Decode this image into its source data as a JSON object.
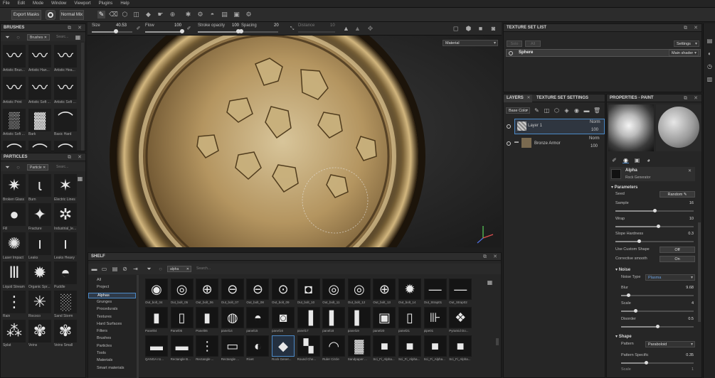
{
  "menu": [
    "File",
    "Edit",
    "Mode",
    "Window",
    "Viewport",
    "Plugins",
    "Help"
  ],
  "toolbar": {
    "export_masks": "Export Masks",
    "normal_mix": "Normal Mix"
  },
  "brush_settings": {
    "size_label": "Size",
    "size_value": "40.53",
    "size_fraction": 0.6,
    "flow_label": "Flow",
    "flow_value": "100",
    "flow_fraction": 1.0,
    "stroke_opacity_label": "Stroke opacity",
    "stroke_opacity_value": "100",
    "stroke_opacity_fraction": 1.0,
    "spacing_label": "Spacing",
    "spacing_value": "20",
    "spacing_fraction": 0.0,
    "distance_label": "Distance",
    "distance_value": "10"
  },
  "brushes": {
    "title": "BRUSHES",
    "tag": "Brushes",
    "search_placeholder": "Searc...",
    "items": [
      "Artistic Brus...",
      "Artistic Han...",
      "Artistic Hea...",
      "Artistic Print",
      "Artistic Soft ...",
      "Artistic Soft ...",
      "Artistic Soft ...",
      "Bark",
      "Basic Hard",
      "",
      "",
      ""
    ]
  },
  "particles": {
    "title": "PARTICLES",
    "tag": "Particle",
    "search_placeholder": "Searc...",
    "items": [
      "Broken Glass",
      "Burn",
      "Electric Lines",
      "Fill",
      "Fracture",
      "Industrial_le...",
      "Laser Impact",
      "Leaks",
      "Leaks Heavy",
      "Liquid Stream",
      "Organic Spr...",
      "Puddle",
      "Rain",
      "Rococo",
      "Sand Storm",
      "Splat",
      "Veins",
      "Veins Small"
    ]
  },
  "viewport": {
    "mode": "Material"
  },
  "texture_set_list": {
    "title": "TEXTURE SET LIST",
    "settings": "Settings",
    "solo": "Solo",
    "all": "All",
    "set_name": "Sphere",
    "shader": "Main shader"
  },
  "layers": {
    "tab_layers": "LAYERS",
    "tab_tss": "TEXTURE SET SETTINGS",
    "channel": "Base Colo",
    "items": [
      {
        "name": "Layer 1",
        "blend": "Norm",
        "opacity": "100"
      },
      {
        "name": "Bronze Armor",
        "blend": "Norm",
        "opacity": "100"
      }
    ]
  },
  "properties": {
    "title": "PROPERTIES - PAINT",
    "alpha_title": "Alpha",
    "alpha_sub": "Rock Generator",
    "parameters": "Parameters",
    "seed_label": "Seed",
    "seed_btn": "Random",
    "sample_label": "Sample",
    "sample_value": "16",
    "sample_fraction": 0.5,
    "wrap_label": "Wrap",
    "wrap_value": "10",
    "wrap_fraction": 0.55,
    "slope_label": "Slope Hardness",
    "slope_value": "0.3",
    "slope_fraction": 0.3,
    "custom_shape_label": "Use Custom Shape",
    "custom_shape_value": "Off",
    "corrective_label": "Corrective smooth",
    "corrective_value": "On",
    "noise": "Noise",
    "noise_type_label": "Noise Type",
    "noise_type_value": "Plasma",
    "blur_label": "Blur",
    "blur_value": "9.68",
    "blur_fraction": 0.1,
    "scale_label": "Scale",
    "scale_value": "4",
    "scale_fraction": 0.2,
    "disorder_label": "Disorder",
    "disorder_value": "0.5",
    "disorder_fraction": 0.5,
    "shape": "Shape",
    "pattern_label": "Pattern",
    "pattern_value": "Paraboloid",
    "pattern_specific_label": "Pattern Specific",
    "pattern_specific_value": "0.35",
    "pattern_specific_fraction": 0.35,
    "scale2_label": "Scale",
    "scale2_value": "1"
  },
  "shelf": {
    "title": "SHELF",
    "filter_tag": "alpha",
    "search_placeholder": "Search...",
    "categories": [
      "All",
      "Project",
      "Alphas",
      "Grunges",
      "Procedurals",
      "Textures",
      "Hard Surfaces",
      "Filters",
      "Brushes",
      "Particles",
      "Tools",
      "Materials",
      "Smart materials"
    ],
    "selected_category": "Alphas",
    "items": [
      "Out_bolt_04",
      "Out_bolt_05",
      "Out_bolt_06",
      "Out_bolt_07",
      "Out_bolt_08",
      "Out_bolt_09",
      "Out_bolt_10",
      "Out_bolt_11",
      "Out_bolt_12",
      "Out_bolt_13",
      "Out_bolt_14",
      "Out_Strap01",
      "Out_Strap02",
      "Panel04",
      "Panel05",
      "Panel06",
      "panel14",
      "panel15",
      "panel16",
      "panel17",
      "panel18",
      "panel19",
      "panel20",
      "panel21",
      "pipe01",
      "Pyramid Do...",
      "QANGA n1...",
      "Rectangle B...",
      "Rectangle ...",
      "Rectangle ...",
      "Rivet",
      "Rock Gener...",
      "Round Che...",
      "Ruler Circle",
      "Sandpaper ...",
      "Sci_Fi_Alpha...",
      "Sci_Fi_Alpha...",
      "Sci_Fi_Alpha...",
      "Sci_Fi_Alpha..."
    ]
  }
}
